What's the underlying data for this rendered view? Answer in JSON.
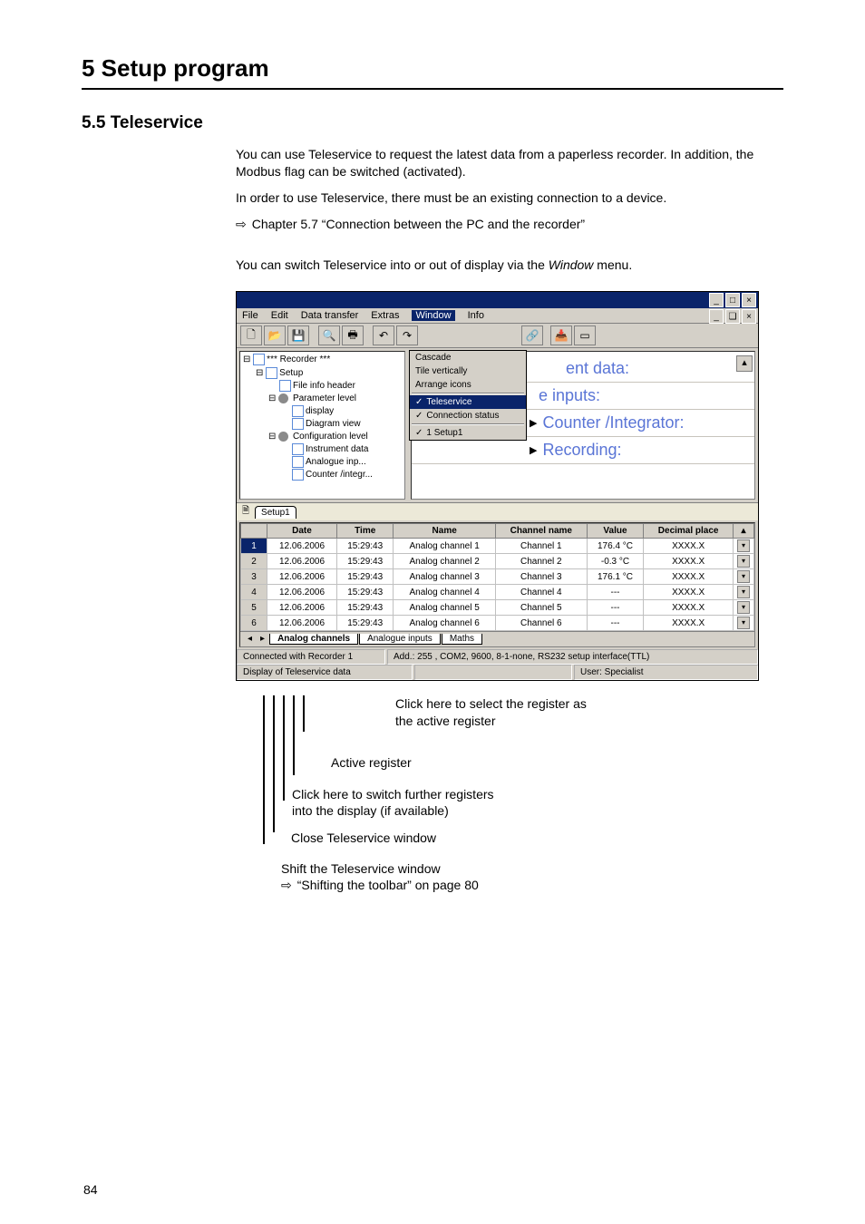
{
  "chapter_title": "5 Setup program",
  "section_title": "5.5  Teleservice",
  "para1": "You can use Teleservice to request the latest data from a paperless recorder. In addition, the Modbus flag can be switched (activated).",
  "para2": "In order to use Teleservice, there must be an existing connection to a device.",
  "para3": "Chapter 5.7 “Connection between the PC and the recorder”",
  "para4a": "You can switch Teleservice into or out of display via the ",
  "para4b": "Window",
  "para4c": " menu.",
  "menubar": {
    "file": "File",
    "edit": "Edit",
    "dtx": "Data transfer",
    "extras": "Extras",
    "window": "Window",
    "info": "Info"
  },
  "inner_winctrls": {
    "min": "_",
    "max": "❏",
    "close": "×"
  },
  "dropdown": {
    "cascade": "Cascade",
    "tilev": "Tile vertically",
    "arrange": "Arrange icons",
    "teleservice": "Teleservice",
    "conn": "Connection status",
    "setup": "1 Setup1"
  },
  "tree": {
    "root": "*** Recorder ***",
    "setup": "Setup",
    "fileinfo": "File info header",
    "param": "Parameter level",
    "display": "display",
    "diagram": "Diagram view",
    "config": "Configuration level",
    "instr": "Instrument data",
    "analog": "Analogue inp...",
    "counter": "Counter /integr..."
  },
  "rightlinks": {
    "l1": "ent data:",
    "l2": "e inputs:",
    "l3": "Counter /Integrator:",
    "l4": "Recording:"
  },
  "tabrow_label": "Setup1",
  "grid": {
    "headers": [
      "",
      "Date",
      "Time",
      "Name",
      "Channel name",
      "Value",
      "Decimal place"
    ],
    "rows": [
      [
        "1",
        "12.06.2006",
        "15:29:43",
        "Analog channel 1",
        "Channel 1",
        "176.4 °C",
        "XXXX.X"
      ],
      [
        "2",
        "12.06.2006",
        "15:29:43",
        "Analog channel 2",
        "Channel 2",
        "-0.3 °C",
        "XXXX.X"
      ],
      [
        "3",
        "12.06.2006",
        "15:29:43",
        "Analog channel 3",
        "Channel 3",
        "176.1 °C",
        "XXXX.X"
      ],
      [
        "4",
        "12.06.2006",
        "15:29:43",
        "Analog channel 4",
        "Channel 4",
        "---",
        "XXXX.X"
      ],
      [
        "5",
        "12.06.2006",
        "15:29:43",
        "Analog channel 5",
        "Channel 5",
        "---",
        "XXXX.X"
      ],
      [
        "6",
        "12.06.2006",
        "15:29:43",
        "Analog channel 6",
        "Channel 6",
        "---",
        "XXXX.X"
      ]
    ],
    "tabs": {
      "t1": "Analog channels",
      "t2": "Analogue inputs",
      "t3": "Maths"
    }
  },
  "status": {
    "connected": "Connected with Recorder 1",
    "addr": "Add.: 255 , COM2, 9600, 8-1-none, RS232 setup interface(TTL)",
    "display": "Display of Teleservice data",
    "user": "User: Specialist"
  },
  "callouts": {
    "c1a": "Click here to select the register as",
    "c1b": "the active register",
    "c2": "Active register",
    "c3a": "Click here to switch further registers",
    "c3b": "into the display (if available)",
    "c4": "Close Teleservice window",
    "c5a": "Shift the Teleservice window",
    "c5b": "“Shifting the  toolbar” on page 80"
  },
  "page_number": "84"
}
